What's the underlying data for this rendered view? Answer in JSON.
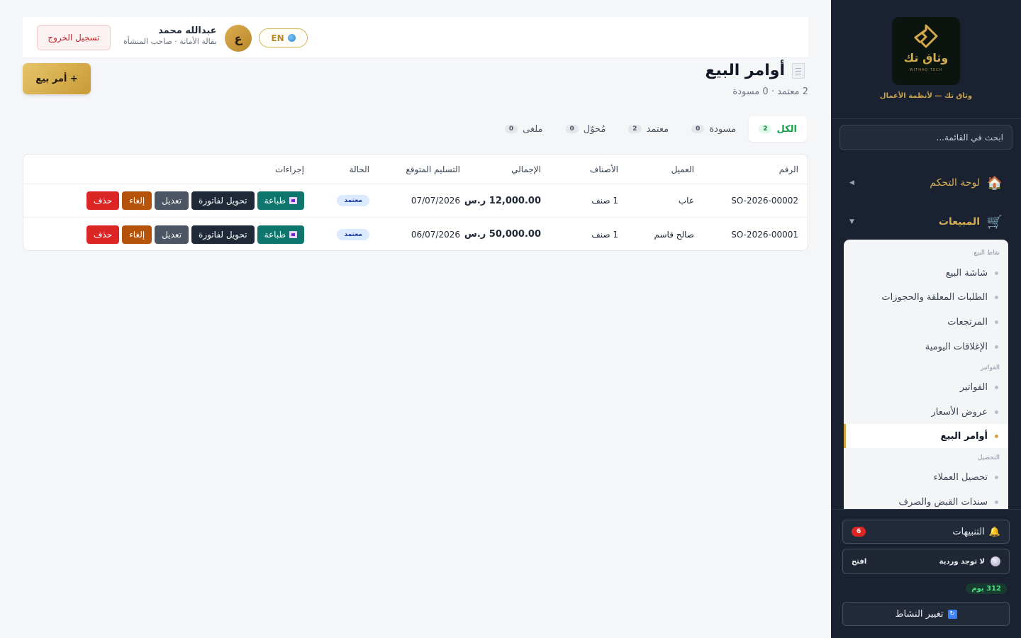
{
  "brand": {
    "logo_text": "وثاق تك",
    "logo_sub": "WITHAQ TECH",
    "tagline": "وثاق تك — لأنظمة الأعمال"
  },
  "sidebar": {
    "search_placeholder": "ابحث في القائمة...",
    "nav": [
      {
        "label": "لوحة التحكم",
        "icon": "home-icon"
      },
      {
        "label": "المبيعات",
        "icon": "cart-icon"
      }
    ],
    "sections": {
      "pos": "نقاط البيع",
      "invoices": "الفواتير",
      "collection": "التحصيل"
    },
    "items": [
      {
        "label": "شاشة البيع"
      },
      {
        "label": "الطلبات المعلقة والحجوزات"
      },
      {
        "label": "المرتجعات"
      },
      {
        "label": "الإغلاقات اليومية"
      },
      {
        "label": "الفواتير"
      },
      {
        "label": "عروض الأسعار"
      },
      {
        "label": "أوامر البيع",
        "active": true
      },
      {
        "label": "تحصيل العملاء"
      },
      {
        "label": "سندات القبض والصرف"
      }
    ],
    "alerts_label": "التنبيهات",
    "alerts_count": "6",
    "shift_label": "لا توجد وردية",
    "shift_open": "افتح",
    "days_badge": "312 يوم",
    "switch_label": "تغيير النشاط"
  },
  "topbar": {
    "logout": "تسجيل الخروج",
    "user_name": "عبدالله محمد",
    "user_role": "بقالة الأمانة · صاحب المنشأة",
    "avatar_letter": "ع",
    "lang": "EN"
  },
  "page": {
    "title": "أوامر البيع",
    "subtitle": "2 معتمد · 0 مسودة",
    "new_button": "+ أمر بيع"
  },
  "tabs": [
    {
      "label": "الكل",
      "count": "2",
      "active": true
    },
    {
      "label": "مسودة",
      "count": "0"
    },
    {
      "label": "معتمد",
      "count": "2"
    },
    {
      "label": "مُحوّل",
      "count": "0"
    },
    {
      "label": "ملغى",
      "count": "0"
    }
  ],
  "table": {
    "headers": {
      "number": "الرقم",
      "customer": "العميل",
      "items": "الأصناف",
      "total": "الإجمالي",
      "delivery": "التسليم المتوقع",
      "status": "الحالة",
      "actions": "إجراءات"
    },
    "rows": [
      {
        "number": "SO-2026-00002",
        "customer": "عاب",
        "items": "1 صنف",
        "total": "12,000.00 ر.س",
        "delivery": "07/07/2026",
        "status": "معتمد"
      },
      {
        "number": "SO-2026-00001",
        "customer": "صالح قاسم",
        "items": "1 صنف",
        "total": "50,000.00 ر.س",
        "delivery": "06/07/2026",
        "status": "معتمد"
      }
    ],
    "action_labels": {
      "print": "طباعة",
      "convert": "تحويل لفاتورة",
      "edit": "تعديل",
      "cancel": "إلغاء",
      "delete": "حذف"
    }
  },
  "colors": {
    "sidebar_bg": "#1a2232",
    "gold": "#d4a53f",
    "active_tab": "#16a34a",
    "status_badge": "#dbeafe",
    "print": "#0f766e",
    "convert": "#1f2937",
    "edit": "#4b5563",
    "cancel": "#b45309",
    "delete": "#dc2626"
  }
}
